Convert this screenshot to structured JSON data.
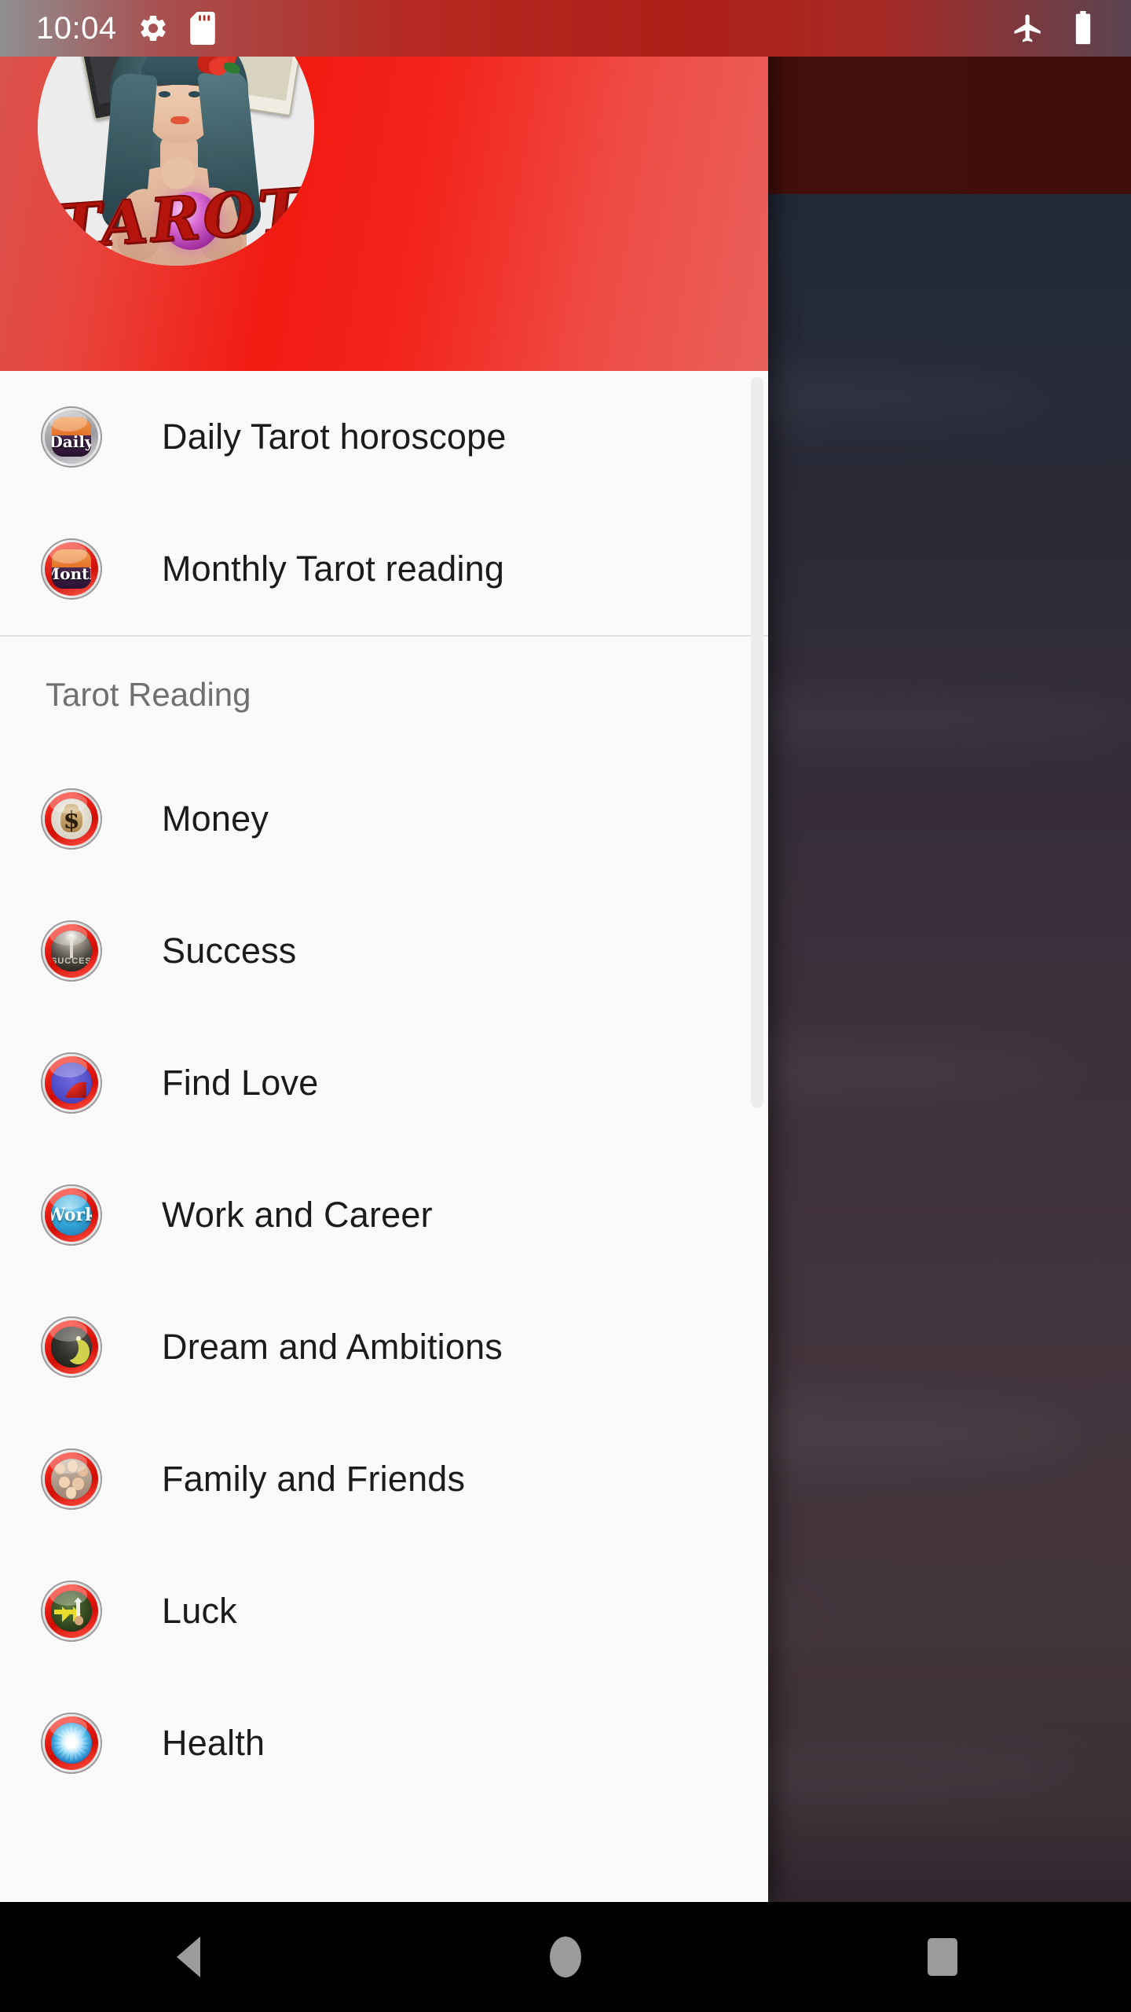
{
  "status_bar": {
    "clock": "10:04",
    "left_icons": [
      {
        "name": "settings-gear-icon",
        "glyph": "gear"
      },
      {
        "name": "sd-card-icon",
        "glyph": "sd-card"
      }
    ],
    "right_icons": [
      {
        "name": "airplane-mode-icon",
        "glyph": "airplane"
      },
      {
        "name": "battery-full-icon",
        "glyph": "battery"
      }
    ]
  },
  "drawer": {
    "header": {
      "avatar_alt": "Tarot",
      "avatar_word": "TAROT",
      "accent_color": "#f21b12"
    },
    "top_items": [
      {
        "label": "Daily Tarot horoscope",
        "icon": "daily-badge-icon",
        "badge_text": "Daily"
      },
      {
        "label": "Monthly Tarot reading",
        "icon": "month-badge-icon",
        "badge_text": "Month"
      }
    ],
    "section_title": "Tarot Reading",
    "reading_items": [
      {
        "label": "Money",
        "icon": "money-bag-icon",
        "icon_text": "$"
      },
      {
        "label": "Success",
        "icon": "success-arrow-icon",
        "icon_text": "SUCCESS"
      },
      {
        "label": "Find Love",
        "icon": "heart-icon",
        "icon_text": ""
      },
      {
        "label": "Work and Career",
        "icon": "work-globe-icon",
        "icon_text": "Work"
      },
      {
        "label": "Dream and Ambitions",
        "icon": "crescent-moon-icon",
        "icon_text": ""
      },
      {
        "label": "Family and Friends",
        "icon": "family-photo-icon",
        "icon_text": ""
      },
      {
        "label": "Luck",
        "icon": "arrows-up-icon",
        "icon_text": ""
      },
      {
        "label": "Health",
        "icon": "starburst-icon",
        "icon_text": ""
      }
    ]
  },
  "nav_bar": {
    "back": "back-button",
    "home": "home-button",
    "recents": "recents-button"
  },
  "colors": {
    "drawer_bg": "#fafafa",
    "header_red": "#f21b12",
    "status_red": "#b52a22",
    "text_primary": "#1b1b1b",
    "text_secondary": "#707070",
    "divider": "#e0e0e0"
  }
}
